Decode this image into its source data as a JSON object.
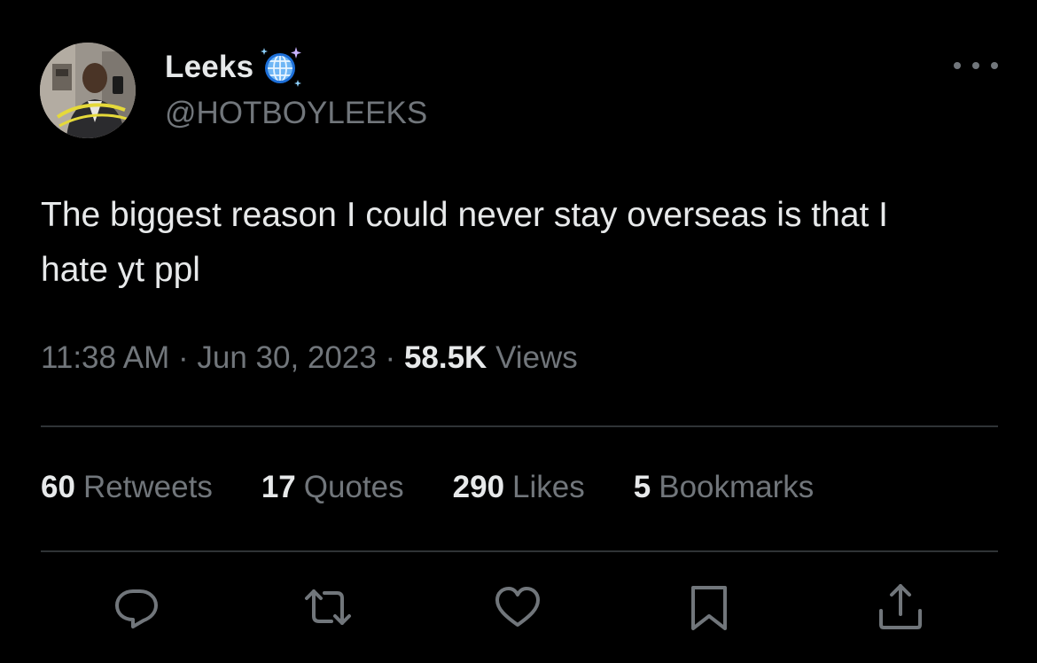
{
  "author": {
    "display_name": "Leeks",
    "handle": "@HOTBOYLEEKS",
    "badge_icon": "globe-icon",
    "avatar_icon": "profile-photo"
  },
  "tweet": {
    "text": "The biggest reason I could never stay overseas is that I hate yt ppl",
    "time": "11:38 AM",
    "separator": "·",
    "date": "Jun 30, 2023",
    "views_count": "58.5K",
    "views_label": "Views"
  },
  "stats": {
    "retweets_count": "60",
    "retweets_label": "Retweets",
    "quotes_count": "17",
    "quotes_label": "Quotes",
    "likes_count": "290",
    "likes_label": "Likes",
    "bookmarks_count": "5",
    "bookmarks_label": "Bookmarks"
  },
  "actions": [
    "reply-icon",
    "retweet-icon",
    "like-icon",
    "bookmark-icon",
    "share-icon"
  ],
  "colors": {
    "background": "#000000",
    "primary_text": "#e7e9ea",
    "secondary_text": "#71767b",
    "divider": "#2f3336"
  }
}
